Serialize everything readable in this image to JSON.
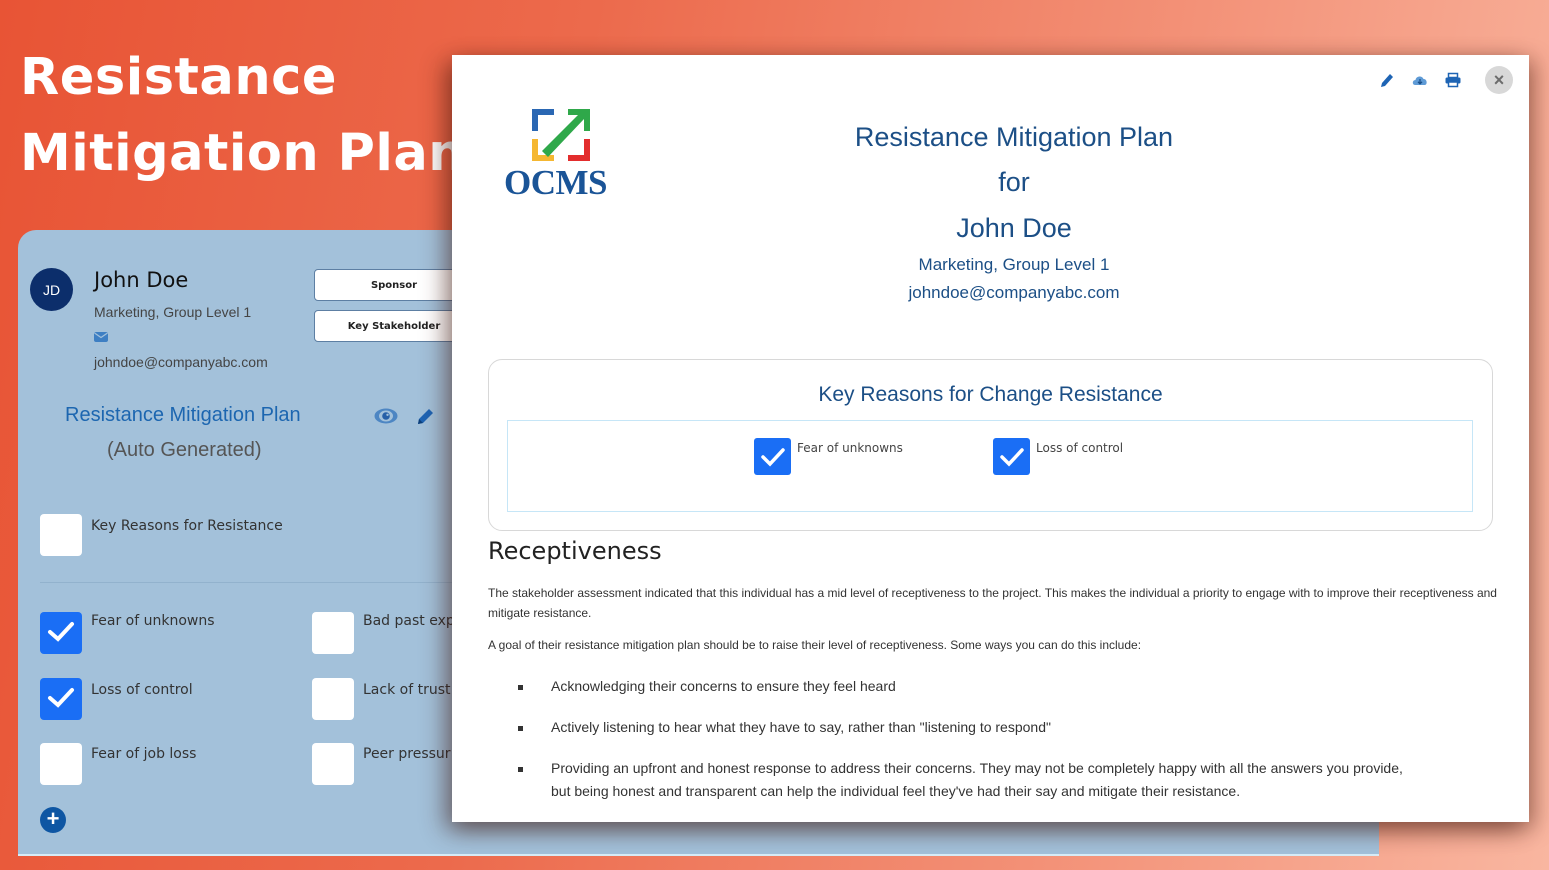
{
  "hero": {
    "title_line1": "Resistance",
    "title_line2": "Mitigation Plan"
  },
  "app_panel": {
    "avatar_initials": "JD",
    "person_name": "John Doe",
    "department": "Marketing, Group Level 1",
    "email": "johndoe@companyabc.com",
    "role_buttons": [
      "Sponsor",
      "Key Stakeholder"
    ],
    "plan_link": "Resistance Mitigation Plan",
    "plan_subtitle": "(Auto Generated)",
    "key_reasons_label": "Key Reasons for Resistance",
    "key_reasons_checked": false,
    "reasons": [
      {
        "label": "Fear of unknowns",
        "checked": true
      },
      {
        "label": "Bad past exp",
        "checked": false
      },
      {
        "label": "Loss of control",
        "checked": true
      },
      {
        "label": "Lack of trust",
        "checked": false
      },
      {
        "label": "Fear of job loss",
        "checked": false
      },
      {
        "label": "Peer pressur",
        "checked": false
      }
    ],
    "add_icon": "+"
  },
  "modal": {
    "toolbar": [
      "pencil-icon",
      "cloud-download-icon",
      "print-icon",
      "close-icon"
    ],
    "close_glyph": "×",
    "logo_text": "OCMS",
    "header": {
      "title": "Resistance Mitigation Plan",
      "for": "for",
      "name": "John Doe",
      "department": "Marketing, Group Level 1",
      "email": "johndoe@companyabc.com"
    },
    "reasons_card": {
      "title": "Key Reasons for Change Resistance",
      "items": [
        {
          "label": "Fear of unknowns",
          "checked": true
        },
        {
          "label": "Loss of control",
          "checked": true
        }
      ]
    },
    "receptiveness": {
      "heading": "Receptiveness",
      "paragraph1": "The stakeholder assessment indicated that this individual has a mid level of receptiveness to the project. This makes the individual a priority to engage with to improve their receptiveness and mitigate resistance.",
      "paragraph2": "A goal of their resistance mitigation plan should be to raise their level of receptiveness. Some ways you can do this include:",
      "bullets": [
        "Acknowledging their concerns to ensure they feel heard",
        "Actively listening to hear what they have to say, rather than \"listening to respond\"",
        "Providing an upfront and honest response to address their concerns. They may not be completely happy with all the answers you provide, but being honest and transparent can help the individual feel they've had their say and mitigate their resistance."
      ]
    }
  },
  "colors": {
    "accent_blue": "#1a6ef5",
    "heading_blue": "#1c4f86",
    "panel_bg": "#a3c1da",
    "avatar_bg": "#0c2e6b",
    "background_orange": "#e85435"
  }
}
